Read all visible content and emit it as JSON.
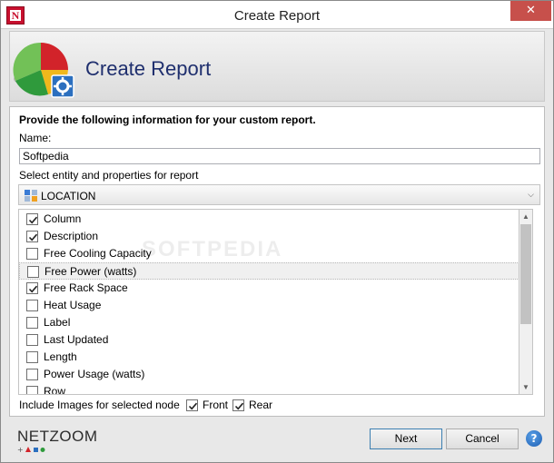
{
  "window": {
    "title": "Create Report",
    "close_glyph": "✕",
    "app_icon_letter": "N"
  },
  "header": {
    "title": "Create Report",
    "icon": "pie-chart-gear-icon"
  },
  "form": {
    "instructions": "Provide the following information for your custom report.",
    "name_label": "Name:",
    "name_value": "Softpedia",
    "entity_label": "Select entity and properties for report",
    "entity_value": "LOCATION",
    "properties": [
      {
        "label": "Column",
        "checked": true
      },
      {
        "label": "Description",
        "checked": true
      },
      {
        "label": "Free Cooling Capacity",
        "checked": false
      },
      {
        "label": "Free Power (watts)",
        "checked": false,
        "hovered": true
      },
      {
        "label": "Free Rack Space",
        "checked": true
      },
      {
        "label": "Heat Usage",
        "checked": false
      },
      {
        "label": "Label",
        "checked": false
      },
      {
        "label": "Last Updated",
        "checked": false
      },
      {
        "label": "Length",
        "checked": false
      },
      {
        "label": "Power Usage (watts)",
        "checked": false
      },
      {
        "label": "Row",
        "checked": false
      }
    ],
    "include_images_label": "Include Images for selected node",
    "front_label": "Front",
    "front_checked": true,
    "rear_label": "Rear",
    "rear_checked": true
  },
  "watermark": "SOFTPEDIA",
  "footer": {
    "logo_text": "NETZOOM",
    "next_label": "Next",
    "cancel_label": "Cancel",
    "help_glyph": "?"
  },
  "colors": {
    "header_title": "#1f2f6e",
    "close_button": "#c7504b",
    "brand_red": "#c8102e",
    "primary_border": "#3c7fb1"
  }
}
